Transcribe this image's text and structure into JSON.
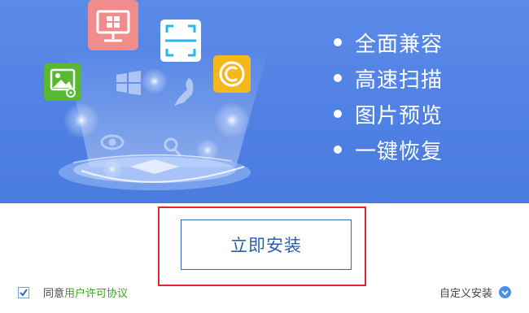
{
  "features": [
    "全面兼容",
    "高速扫描",
    "图片预览",
    "一键恢复"
  ],
  "install_button": "立即安装",
  "agreement": {
    "checked": true,
    "prefix": "同意",
    "link": "用户许可协议"
  },
  "custom_install": "自定义安装",
  "colors": {
    "banner": "#4f80e3",
    "button_text": "#2a5fb0",
    "highlight": "#e0262b",
    "link": "#3f9e2a"
  },
  "icons": [
    "monitor-app-icon",
    "scan-app-icon",
    "photo-app-icon",
    "copyright-app-icon",
    "windows-logo-icon",
    "rocket-icon",
    "eye-icon",
    "magnifier-icon",
    "platform-disk"
  ]
}
